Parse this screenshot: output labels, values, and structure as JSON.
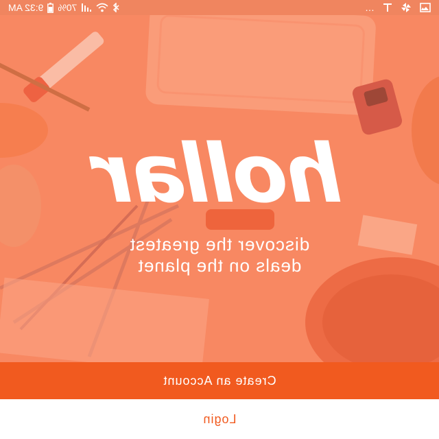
{
  "status_bar": {
    "time": "9:32 AM",
    "battery": "70%",
    "icons": [
      "gallery-icon",
      "pinwheel-icon",
      "t-mobile-icon",
      "more-dots-icon",
      "bluetooth-icon",
      "wifi-icon",
      "signal-icon",
      "battery-icon"
    ],
    "more": "…"
  },
  "hero": {
    "logo": "hollar",
    "tagline": [
      "discover the greatest",
      "deals on the planet"
    ]
  },
  "actions": {
    "create_account": "Create an Account",
    "login": "Login"
  },
  "colors": {
    "brand": "#f15a1f",
    "hero": "#f8916d",
    "text": "#ffffff"
  }
}
